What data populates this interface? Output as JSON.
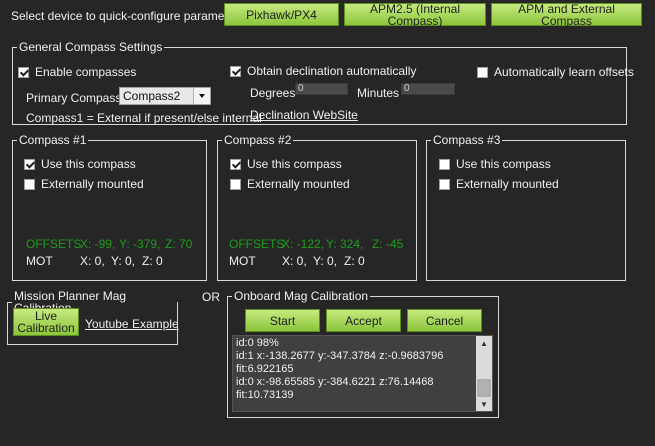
{
  "top": {
    "label": "Select device to quick-configure parameters:",
    "buttons": [
      "Pixhawk/PX4",
      "APM2.5 (Internal Compass)",
      "APM and External Compass"
    ]
  },
  "general": {
    "legend": "General Compass Settings",
    "enable_label": "Enable compasses",
    "enable_checked": true,
    "primary_label": "Primary Compass:",
    "primary_value": "Compass2",
    "note": "Compass1 = External if present/else internal",
    "declination_label": "Obtain declination automatically",
    "declination_checked": true,
    "degrees_label": "Degrees",
    "degrees_value": "0",
    "minutes_label": "Minutes",
    "minutes_value": "0",
    "website_link": "Declination WebSite",
    "learn_label": "Automatically learn offsets",
    "learn_checked": false
  },
  "compasses": [
    {
      "legend": "Compass #1",
      "use_label": "Use this compass",
      "use_checked": true,
      "ext_label": "Externally mounted",
      "ext_checked": false,
      "offsets_label": "OFFSETS",
      "off_x": "X: -99,",
      "off_y": "Y: -379,",
      "off_z": "Z: 70",
      "mot_label": "MOT",
      "mot_x": "X: 0,",
      "mot_y": "Y: 0,",
      "mot_z": "Z: 0"
    },
    {
      "legend": "Compass #2",
      "use_label": "Use this compass",
      "use_checked": true,
      "ext_label": "Externally mounted",
      "ext_checked": false,
      "offsets_label": "OFFSETS",
      "off_x": "X: -122,",
      "off_y": "Y: 324,",
      "off_z": "Z: -45",
      "mot_label": "MOT",
      "mot_x": "X: 0,",
      "mot_y": "Y: 0,",
      "mot_z": "Z: 0"
    },
    {
      "legend": "Compass #3",
      "use_label": "Use this compass",
      "use_checked": false,
      "ext_label": "Externally mounted",
      "ext_checked": false
    }
  ],
  "mp_cal": {
    "legend": "Mission Planner Mag Calibration",
    "live_button": "Live Calibration",
    "youtube_link": "Youtube Example"
  },
  "or_label": "OR",
  "onboard": {
    "legend": "Onboard Mag Calibration",
    "start": "Start",
    "accept": "Accept",
    "cancel": "Cancel",
    "log": [
      "id:0 98%",
      "id:1 x:-138.2677 y:-347.3784 z:-0.9683796",
      "fit:6.922165",
      "id:0 x:-98.65585 y:-384.6221 z:76.14468",
      "fit:10.73139"
    ]
  },
  "colors": {
    "background": "#262626",
    "button_green": "#9fd14f",
    "offsets_green": "#1e9a1e"
  }
}
